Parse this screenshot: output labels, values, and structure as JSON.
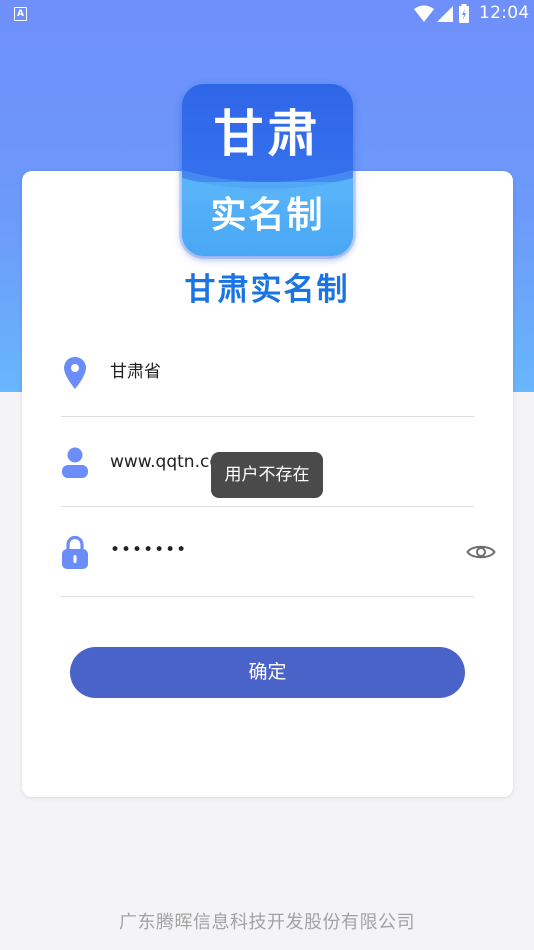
{
  "status_bar": {
    "app_icon_letter": "A",
    "time": "12:04",
    "icons": [
      "wifi-icon",
      "cell-signal-icon",
      "battery-icon"
    ]
  },
  "logo": {
    "top_text": "甘肃",
    "bottom_text": "实名制",
    "colors": {
      "top": "#2f66e8",
      "bottom": "#58b3f8"
    }
  },
  "app_title": "甘肃实名制",
  "form": {
    "province": {
      "value": "甘肃省",
      "icon": "location-pin-icon"
    },
    "username": {
      "value": "www.qqtn.com",
      "icon": "user-icon"
    },
    "password": {
      "value": "•••••••",
      "icon": "lock-icon",
      "toggle_icon": "eye-icon"
    }
  },
  "toast": "用户不存在",
  "confirm_label": "确定",
  "footer": "广东腾晖信息科技开发股份有限公司",
  "colors": {
    "header_gradient_top": "#6f8ffb",
    "header_gradient_bottom": "#68b6fb",
    "icon_blue": "#6a8df7",
    "button": "#4a63c8",
    "title": "#1b74e4"
  }
}
